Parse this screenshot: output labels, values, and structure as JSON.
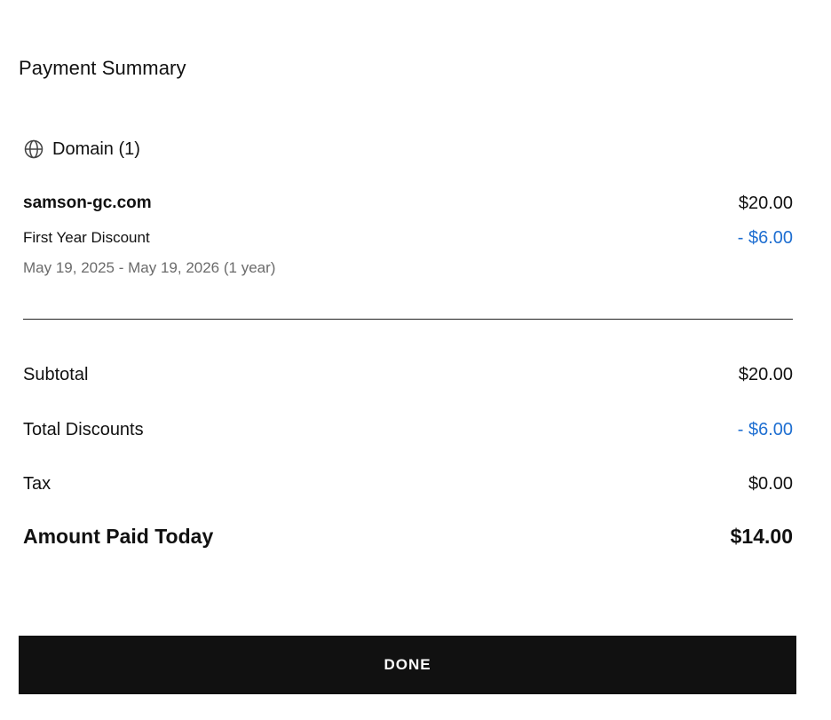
{
  "summary": {
    "title": "Payment Summary"
  },
  "domain_section": {
    "icon": "globe-icon",
    "label": "Domain (1)",
    "item": {
      "name": "samson-gc.com",
      "price": "$20.00",
      "discount_label": "First Year Discount",
      "discount_value": "- $6.00",
      "period": "May 19, 2025 - May 19, 2026 (1 year)"
    }
  },
  "totals": {
    "subtotal_label": "Subtotal",
    "subtotal_value": "$20.00",
    "discounts_label": "Total Discounts",
    "discounts_value": "- $6.00",
    "tax_label": "Tax",
    "tax_value": "$0.00",
    "amount_label": "Amount Paid Today",
    "amount_value": "$14.00"
  },
  "actions": {
    "done_label": "DONE"
  },
  "colors": {
    "discount": "#1f6fd1",
    "button_bg": "#111111",
    "button_text": "#ffffff"
  }
}
